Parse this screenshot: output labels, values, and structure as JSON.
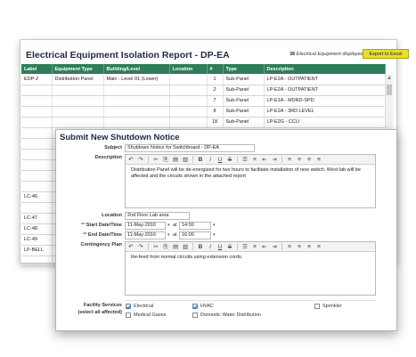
{
  "report": {
    "title": "Electrical Equipment Isolation Report - DP-EA",
    "count": "38",
    "count_suffix": "Electrical Equipment displayed",
    "export_label": "Export to Excel",
    "columns": [
      "Label",
      "Equipment Type",
      "Building/Level",
      "Location",
      "#",
      "Type",
      "Description"
    ],
    "rows": [
      [
        "EDP-2",
        "Distribution Panel",
        "Main - Level 01 (Lower)",
        "",
        "1",
        "Sub-Panel",
        "LP-E2A - OUTPATIENT"
      ],
      [
        "",
        "",
        "",
        "",
        "2",
        "Sub-Panel",
        "LP-E2A - OUTPATIENT"
      ],
      [
        "",
        "",
        "",
        "",
        "7",
        "Sub-Panel",
        "LP-E1A - MDRD-SPD"
      ],
      [
        "",
        "",
        "",
        "",
        "8",
        "Sub-Panel",
        "LP-E2A - 3RD LEVEL"
      ],
      [
        "",
        "",
        "",
        "",
        "18",
        "Sub-Panel",
        "LP-E2G - CCU"
      ],
      [
        "",
        "",
        "",
        "",
        "",
        "",
        ""
      ],
      [
        "",
        "",
        "",
        "",
        "",
        "",
        ""
      ],
      [
        "",
        "",
        "",
        "",
        "",
        "",
        ""
      ],
      [
        "",
        "",
        "",
        "",
        "",
        "",
        ""
      ],
      [
        "",
        "",
        "",
        "",
        "",
        "",
        ""
      ],
      [
        "",
        "",
        "",
        "",
        "",
        "",
        ""
      ],
      [
        "LC-46",
        "",
        "",
        "",
        "",
        "",
        ""
      ],
      [
        "",
        "",
        "",
        "",
        "",
        "",
        ""
      ],
      [
        "LC-47",
        "",
        "",
        "",
        "",
        "",
        ""
      ],
      [
        "LC-48",
        "",
        "",
        "",
        "",
        "",
        ""
      ],
      [
        "LC-49",
        "",
        "",
        "",
        "",
        "",
        ""
      ],
      [
        "LP-BELL",
        "",
        "",
        "",
        "",
        "",
        ""
      ],
      [
        "",
        "",
        "",
        "",
        "",
        "",
        ""
      ]
    ]
  },
  "notice": {
    "title": "Submit New Shutdown Notice",
    "subject_label": "Subject",
    "subject_value": "Shutdown Notice for Switchboard - DP-EA",
    "description_label": "Description",
    "description_text": "Distribution Panel will be de-energized for two hours to facilitate installation of new switch. West lab will be affected and the circuits shown in the attached report",
    "location_label": "Location",
    "location_value": "2nd Floor Lab area",
    "required_marker": "**",
    "start_label": "Start Date/Time",
    "start_date": "11-May-2016",
    "start_time": "14:00",
    "end_label": "End Date/Time",
    "end_date": "11-May-2016",
    "end_time": "16:00",
    "at_text": "at",
    "contingency_label": "Contingency Plan",
    "contingency_text": "Re-feed from normal circuits using extension cords.",
    "facility_label_line1": "Facility Services",
    "facility_label_line2": "(select all affected)",
    "services": [
      {
        "label": "Electrical",
        "checked": true
      },
      {
        "label": "HVAC",
        "checked": true
      },
      {
        "label": "Sprinkler",
        "checked": false
      },
      {
        "label": "Medical Gases",
        "checked": false
      },
      {
        "label": "Domestic Water Distribution",
        "checked": false
      }
    ]
  },
  "colors": {
    "header_green": "#2e7d5b",
    "export_yellow": "#e6e02a",
    "title_navy": "#1f2a44"
  },
  "toolbar_icons": [
    "undo-icon",
    "redo-icon",
    "cut-icon",
    "copy-icon",
    "paste-icon",
    "paste-text-icon",
    "bold-icon",
    "italic-icon",
    "underline-icon",
    "strikethrough-icon",
    "bulleted-list-icon",
    "numbered-list-icon",
    "outdent-icon",
    "indent-icon",
    "align-left-icon",
    "align-center-icon",
    "align-right-icon",
    "justify-icon"
  ]
}
